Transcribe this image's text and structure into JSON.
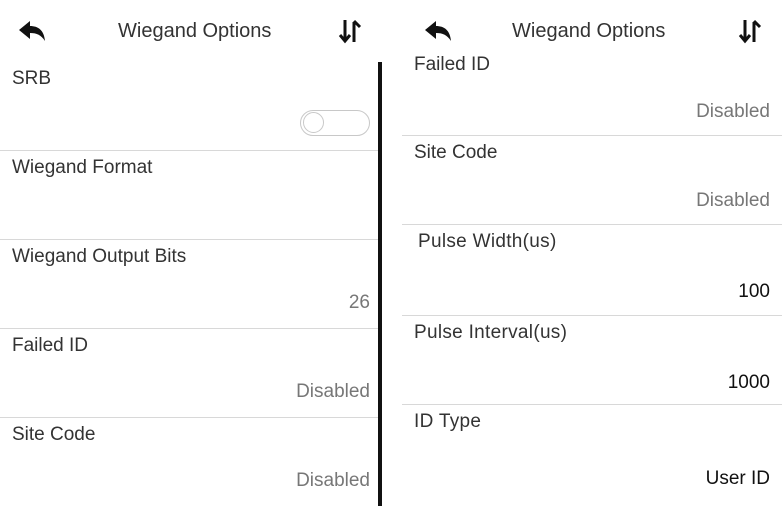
{
  "colors": {
    "background": "#ffffff",
    "divider": "#d8d8d8",
    "label_text": "#333333",
    "value_text": "#777777",
    "scrollbar": "#111111"
  },
  "left_panel": {
    "header": {
      "title": "Wiegand Options",
      "back_icon": "back-arrow-icon",
      "sort_icon": "sort-arrows-icon"
    },
    "rows": [
      {
        "label": "SRB",
        "toggle": "off"
      },
      {
        "label": "Wiegand Format",
        "value": ""
      },
      {
        "label": "Wiegand Output Bits",
        "value": "26"
      },
      {
        "label": "Failed ID",
        "value": "Disabled"
      },
      {
        "label": "Site Code",
        "value": "Disabled"
      }
    ]
  },
  "right_panel": {
    "header": {
      "title": "Wiegand Options",
      "back_icon": "back-arrow-icon",
      "sort_icon": "sort-arrows-icon"
    },
    "rows": [
      {
        "label": "Failed ID",
        "value": "Disabled"
      },
      {
        "label": "Site Code",
        "value": "Disabled"
      },
      {
        "label": "Pulse Width(us)",
        "value": "100"
      },
      {
        "label": "Pulse Interval(us)",
        "value": "1000"
      },
      {
        "label": "ID Type",
        "value": "User ID"
      }
    ]
  }
}
